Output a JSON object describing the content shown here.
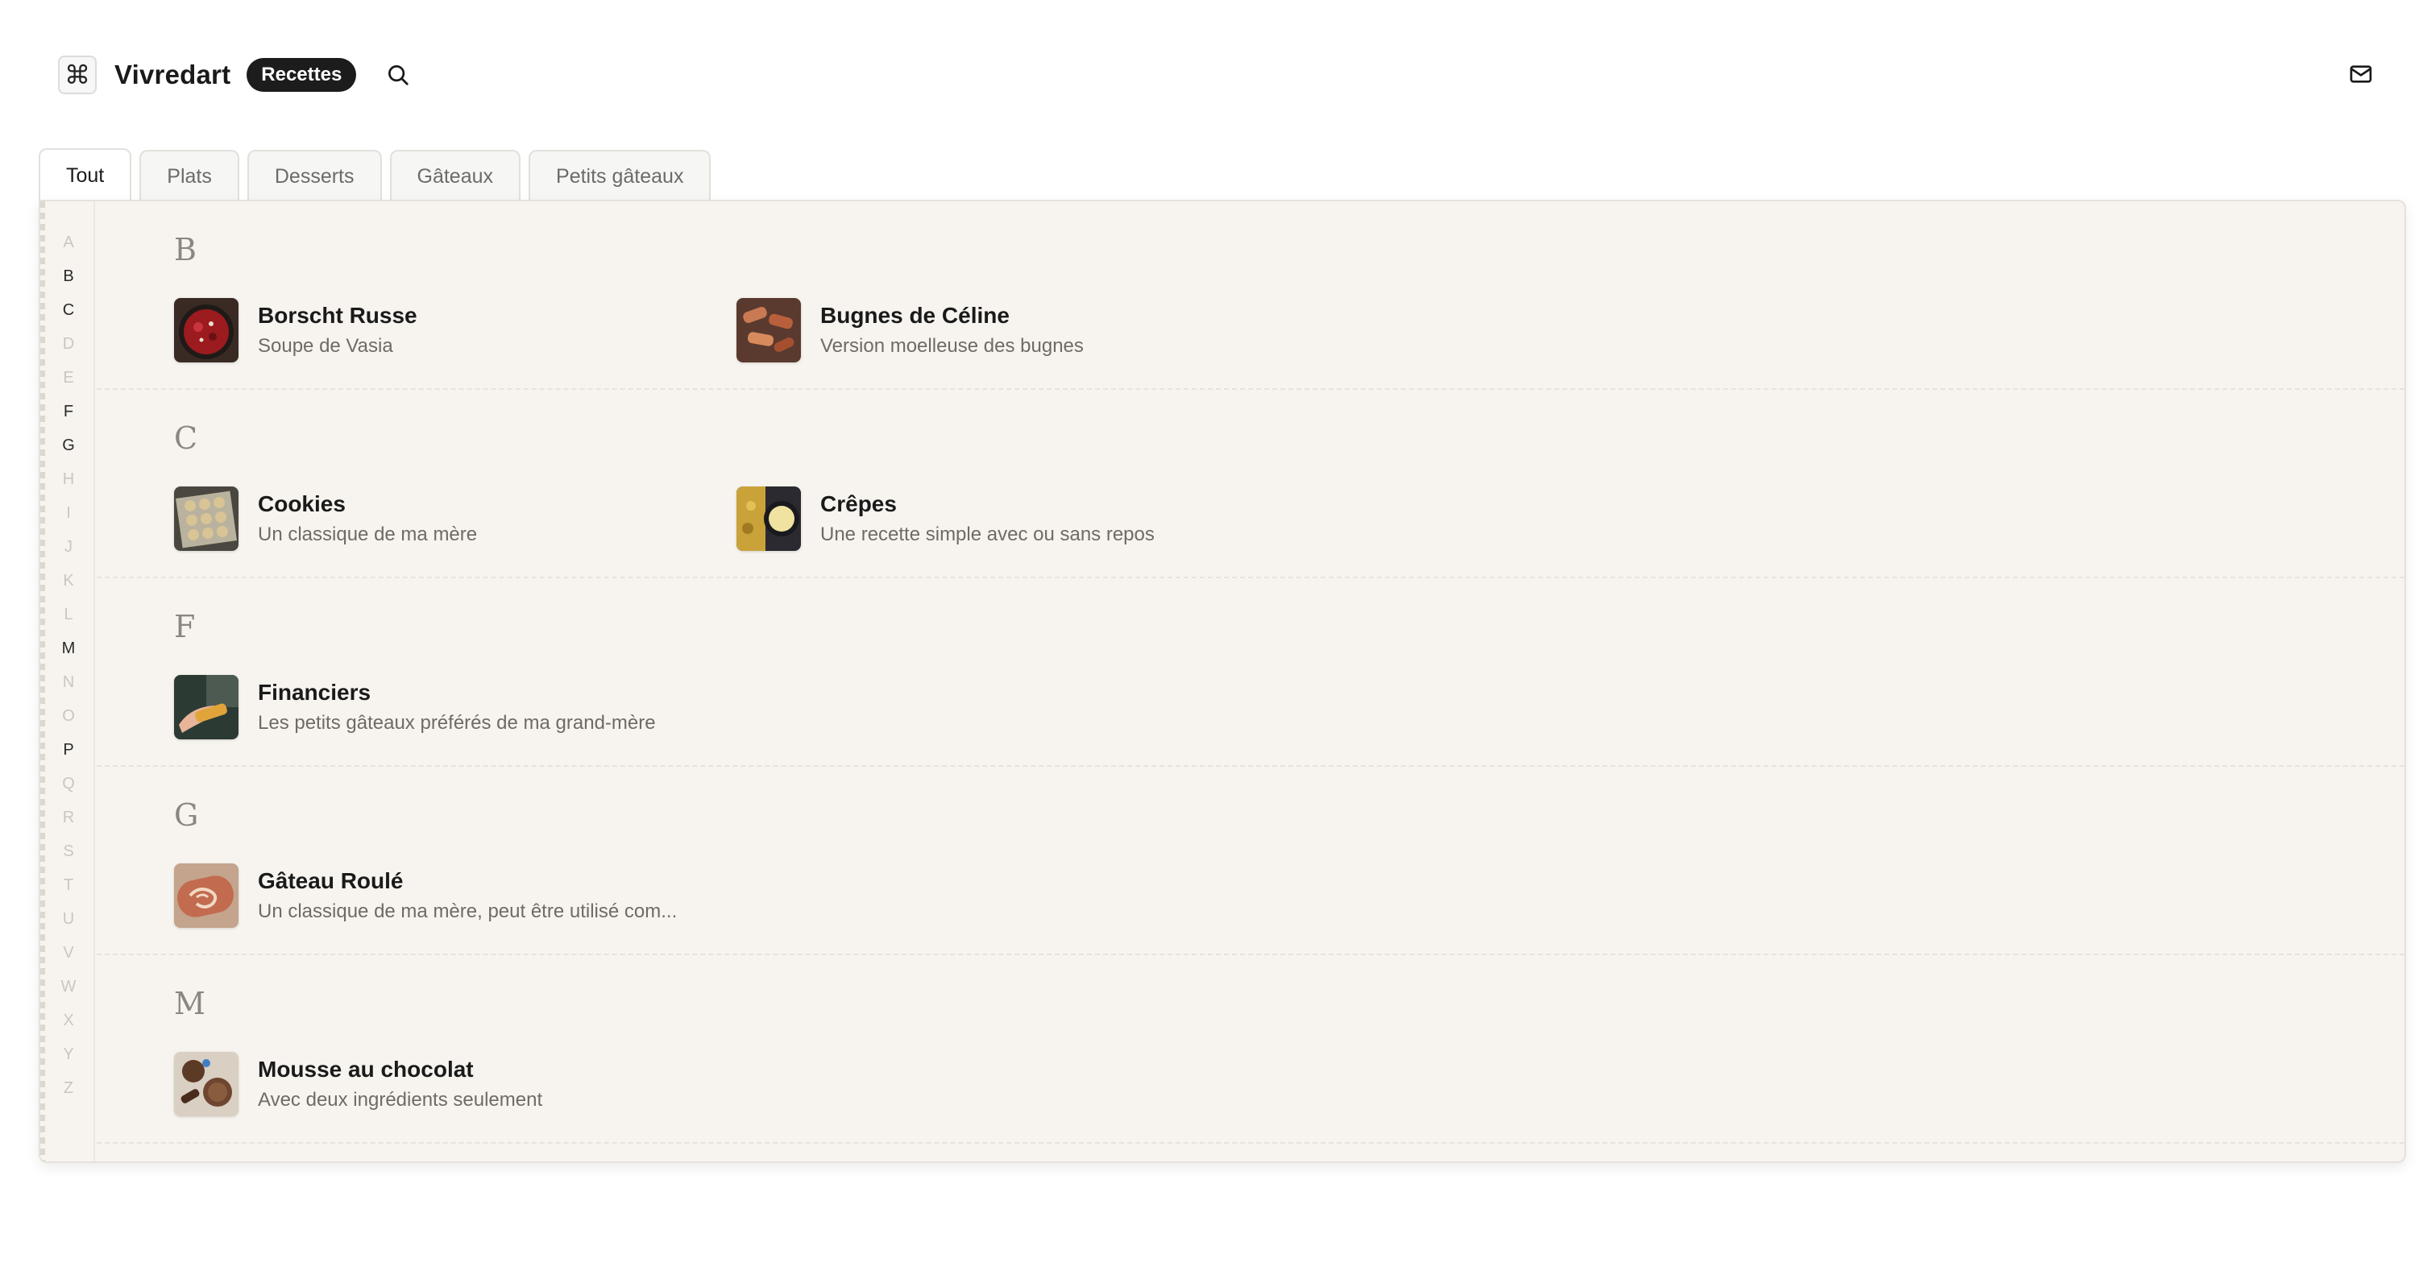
{
  "header": {
    "logo_glyph": "⌘",
    "app_title": "Vivredart",
    "badge": "Recettes"
  },
  "tabs": [
    {
      "label": "Tout",
      "active": true
    },
    {
      "label": "Plats",
      "active": false
    },
    {
      "label": "Desserts",
      "active": false
    },
    {
      "label": "Gâteaux",
      "active": false
    },
    {
      "label": "Petits gâteaux",
      "active": false
    }
  ],
  "alphabet": [
    {
      "letter": "A",
      "enabled": false
    },
    {
      "letter": "B",
      "enabled": true
    },
    {
      "letter": "C",
      "enabled": true
    },
    {
      "letter": "D",
      "enabled": false
    },
    {
      "letter": "E",
      "enabled": false
    },
    {
      "letter": "F",
      "enabled": true
    },
    {
      "letter": "G",
      "enabled": true
    },
    {
      "letter": "H",
      "enabled": false
    },
    {
      "letter": "I",
      "enabled": false
    },
    {
      "letter": "J",
      "enabled": false
    },
    {
      "letter": "K",
      "enabled": false
    },
    {
      "letter": "L",
      "enabled": false
    },
    {
      "letter": "M",
      "enabled": true
    },
    {
      "letter": "N",
      "enabled": false
    },
    {
      "letter": "O",
      "enabled": false
    },
    {
      "letter": "P",
      "enabled": true
    },
    {
      "letter": "Q",
      "enabled": false
    },
    {
      "letter": "R",
      "enabled": false
    },
    {
      "letter": "S",
      "enabled": false
    },
    {
      "letter": "T",
      "enabled": false
    },
    {
      "letter": "U",
      "enabled": false
    },
    {
      "letter": "V",
      "enabled": false
    },
    {
      "letter": "W",
      "enabled": false
    },
    {
      "letter": "X",
      "enabled": false
    },
    {
      "letter": "Y",
      "enabled": false
    },
    {
      "letter": "Z",
      "enabled": false
    }
  ],
  "sections": [
    {
      "letter": "B",
      "recipes": [
        {
          "title": "Borscht Russe",
          "subtitle": "Soupe de Vasia"
        },
        {
          "title": "Bugnes de Céline",
          "subtitle": "Version moelleuse des bugnes"
        }
      ]
    },
    {
      "letter": "C",
      "recipes": [
        {
          "title": "Cookies",
          "subtitle": "Un classique de ma mère"
        },
        {
          "title": "Crêpes",
          "subtitle": "Une recette simple avec ou sans repos"
        }
      ]
    },
    {
      "letter": "F",
      "recipes": [
        {
          "title": "Financiers",
          "subtitle": "Les petits gâteaux préférés de ma grand-mère"
        }
      ]
    },
    {
      "letter": "G",
      "recipes": [
        {
          "title": "Gâteau Roulé",
          "subtitle": "Un classique de ma mère, peut être utilisé com..."
        }
      ]
    },
    {
      "letter": "M",
      "recipes": [
        {
          "title": "Mousse au chocolat",
          "subtitle": "Avec deux ingrédients seulement"
        }
      ]
    }
  ]
}
